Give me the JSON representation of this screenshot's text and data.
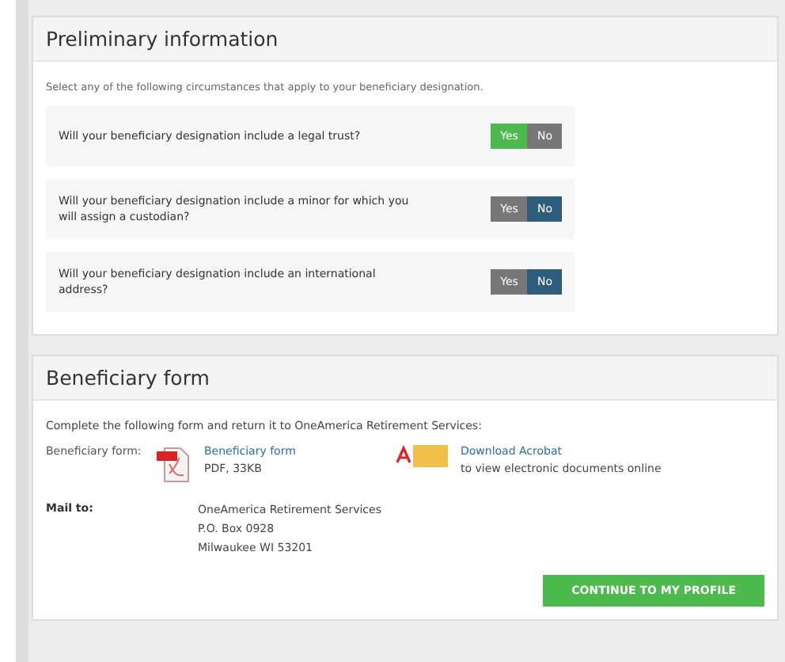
{
  "preliminary": {
    "title": "Preliminary information",
    "intro": "Select any of the following circumstances that apply to your beneficiary designation.",
    "questions": [
      {
        "text": "Will your beneficiary designation include a legal trust?",
        "options": [
          {
            "label": "Yes",
            "kind": "yes",
            "selected": true
          },
          {
            "label": "No",
            "kind": "no",
            "selected": false
          }
        ]
      },
      {
        "text": "Will your beneficiary designation include a minor for which you will assign a custodian?",
        "options": [
          {
            "label": "Yes",
            "kind": "yes",
            "selected": false
          },
          {
            "label": "No",
            "kind": "no",
            "selected": true
          }
        ]
      },
      {
        "text": "Will your beneficiary designation include an international address?",
        "options": [
          {
            "label": "Yes",
            "kind": "yes",
            "selected": false
          },
          {
            "label": "No",
            "kind": "no",
            "selected": true
          }
        ]
      }
    ]
  },
  "beneficiary": {
    "title": "Beneficiary form",
    "intro": "Complete the following form and return it to OneAmerica Retirement Services:",
    "form_label": "Beneficiary form:",
    "form_link": "Beneficiary form",
    "form_info": "PDF, 33KB",
    "acrobat_link": "Download Acrobat",
    "acrobat_info": "to view electronic documents online",
    "mail_label": "Mail to:",
    "mail_lines": [
      "OneAmerica Retirement Services",
      "P.O. Box 0928",
      "Milwaukee WI 53201"
    ],
    "continue_button": "CONTINUE TO MY PROFILE"
  }
}
